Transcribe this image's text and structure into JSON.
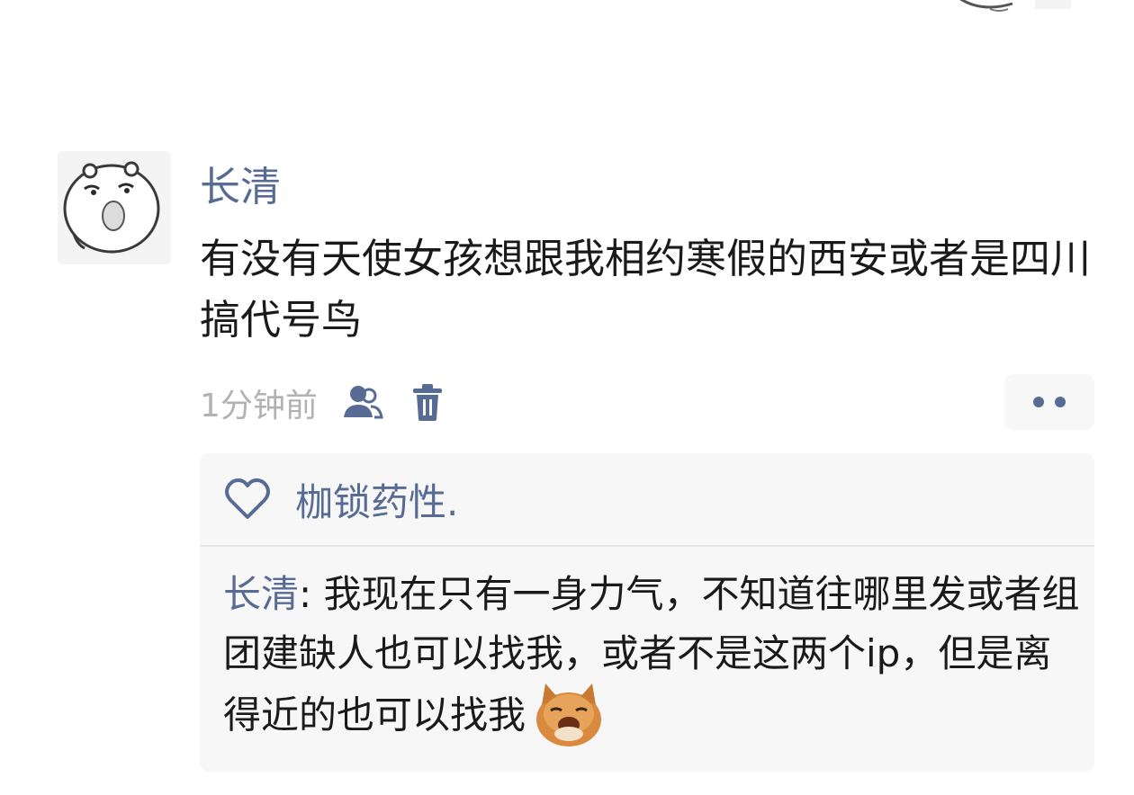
{
  "post": {
    "author": "长清",
    "text": "有没有天使女孩想跟我相约寒假的西安或者是四川搞代号鸟",
    "time": "1分钟前",
    "icons": {
      "visibility": "people-icon",
      "delete": "trash-icon",
      "more": "more-dots-icon"
    }
  },
  "likes": {
    "icon": "heart-icon",
    "names": "枷锁药性."
  },
  "comments": [
    {
      "author": "长清",
      "separator": ": ",
      "text": "我现在只有一身力气，不知道往哪里发或者组团建缺人也可以找我，或者不是这两个ip，但是离得近的也可以找我",
      "sticker": "cat-sticker"
    }
  ],
  "colors": {
    "link": "#576b95",
    "text": "#1a1a1a",
    "meta": "#b2b2b2",
    "panel": "#f7f7f7"
  }
}
